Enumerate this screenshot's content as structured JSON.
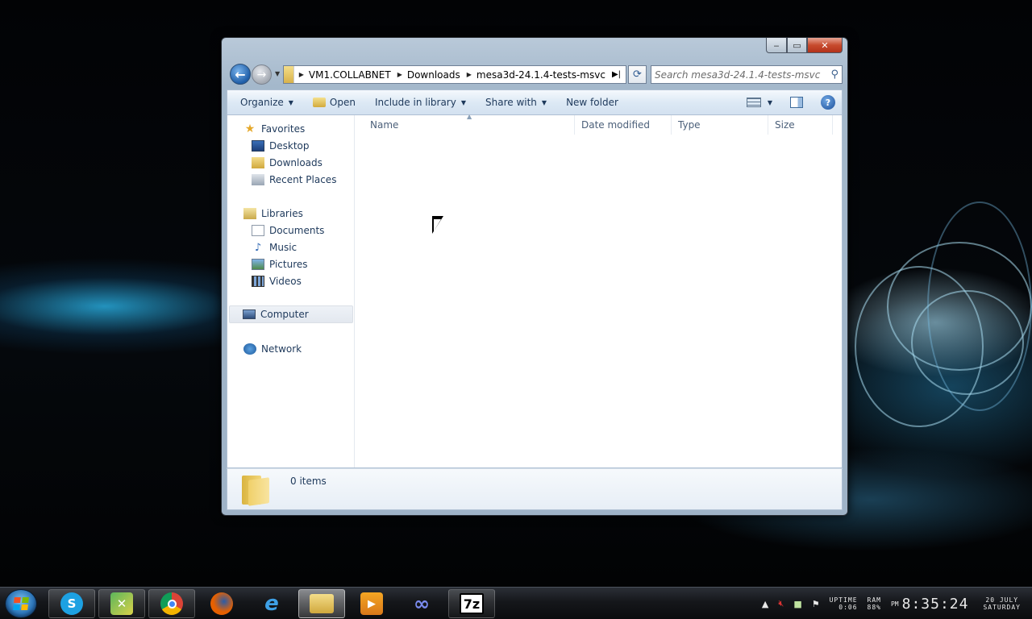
{
  "window": {
    "controls": {
      "minimize": "‒",
      "maximize": "▭",
      "close": "✕"
    }
  },
  "address_bar": {
    "breadcrumbs": [
      "VM1.COLLABNET",
      "Downloads",
      "mesa3d-24.1.4-tests-msvc"
    ],
    "search_placeholder": "Search mesa3d-24.1.4-tests-msvc"
  },
  "toolbar": {
    "organize": "Organize",
    "open": "Open",
    "include_in_library": "Include in library",
    "share_with": "Share with",
    "new_folder": "New folder"
  },
  "nav_pane": {
    "favorites": "Favorites",
    "desktop": "Desktop",
    "downloads": "Downloads",
    "recent_places": "Recent Places",
    "libraries": "Libraries",
    "documents": "Documents",
    "music": "Music",
    "pictures": "Pictures",
    "videos": "Videos",
    "computer": "Computer",
    "network": "Network"
  },
  "columns": {
    "name": "Name",
    "date_modified": "Date modified",
    "type": "Type",
    "size": "Size"
  },
  "details": {
    "item_count": "0 items"
  },
  "taskbar": {
    "apps": [
      "skype-icon",
      "remote-users-icon",
      "chrome-icon",
      "firefox-icon",
      "internet-explorer-icon",
      "windows-explorer-icon",
      "media-player-icon",
      "infinity-app-icon",
      "7zip-icon"
    ],
    "seven_zip_label": "7z",
    "uptime_label": "UPTIME",
    "uptime_value": "0:06",
    "ram_label": "RAM",
    "ram_value": "88%",
    "ampm": "PM",
    "time": "8:35:24",
    "date": "20 JULY",
    "weekday": "SATURDAY"
  }
}
